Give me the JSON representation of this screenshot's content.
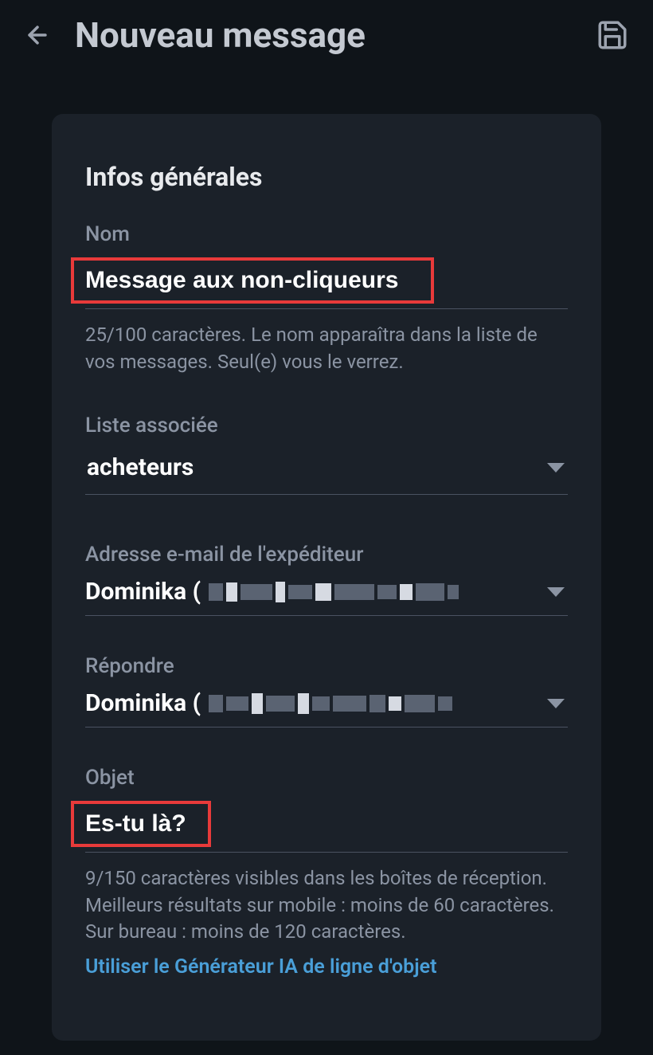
{
  "header": {
    "title": "Nouveau message"
  },
  "card": {
    "section_title": "Infos générales",
    "name": {
      "label": "Nom",
      "value": "Message aux non-cliqueurs",
      "helper": "25/100 caractères. Le nom apparaîtra dans la liste de vos messages. Seul(e) vous le verrez."
    },
    "list": {
      "label": "Liste associée",
      "value": "acheteurs"
    },
    "sender": {
      "label": "Adresse e-mail de l'expéditeur",
      "value": "Dominika ("
    },
    "reply": {
      "label": "Répondre",
      "value": "Dominika ("
    },
    "subject": {
      "label": "Objet",
      "value": "Es-tu là?",
      "helper": "9/150 caractères visibles dans les boîtes de réception. Meilleurs résultats sur mobile : moins de 60 caractères. Sur bureau : moins de 120 caractères.",
      "link": "Utiliser le Générateur IA de ligne d'objet"
    }
  }
}
